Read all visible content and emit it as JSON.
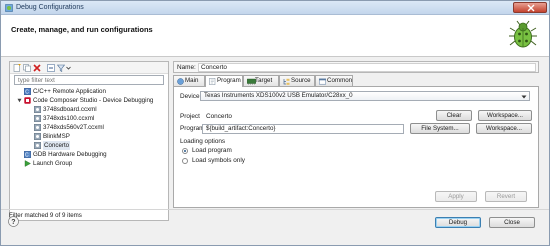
{
  "window": {
    "title": "Debug Configurations",
    "heading": "Create, manage, and run configurations"
  },
  "left": {
    "filter_placeholder": "type filter text",
    "tree": [
      {
        "label": "C/C++ Remote Application",
        "icon": "c-app-icon"
      },
      {
        "label": "Code Composer Studio - Device Debugging",
        "icon": "ccs-icon"
      },
      {
        "label": "3748sdboard.ccxml",
        "icon": "config-icon"
      },
      {
        "label": "3748xds100.ccxml",
        "icon": "config-icon"
      },
      {
        "label": "3748xds560v2T.ccxml",
        "icon": "config-icon"
      },
      {
        "label": "BlinkMSP",
        "icon": "config-icon"
      },
      {
        "label": "Concerto",
        "icon": "config-icon"
      },
      {
        "label": "GDB Hardware Debugging",
        "icon": "gdb-icon"
      },
      {
        "label": "Launch Group",
        "icon": "launch-icon"
      }
    ],
    "status": "Filter matched 9 of 9 items"
  },
  "right": {
    "name_label": "Name:",
    "name_value": "Concerto",
    "tabs": [
      {
        "label": "Main",
        "icon": "main-tab-icon"
      },
      {
        "label": "Program",
        "icon": "program-tab-icon"
      },
      {
        "label": "Target",
        "icon": "target-tab-icon"
      },
      {
        "label": "Source",
        "icon": "source-tab-icon"
      },
      {
        "label": "Common",
        "icon": "common-tab-icon"
      }
    ],
    "active_tab": "Program",
    "device_label": "Device",
    "device_value": "Texas Instruments XDS100v2 USB Emulator/C28xx_0",
    "project_label": "Project",
    "project_value": "Concerto",
    "program_label": "Program",
    "program_value": "${build_artifact:Concerto}",
    "clear_label": "Clear",
    "workspace_label": "Workspace...",
    "filesystem_label": "File System...",
    "loading_options_label": "Loading options",
    "load_program_label": "Load program",
    "load_symbols_label": "Load symbols only",
    "apply_label": "Apply",
    "revert_label": "Revert"
  },
  "footer": {
    "debug_label": "Debug",
    "close_label": "Close"
  }
}
